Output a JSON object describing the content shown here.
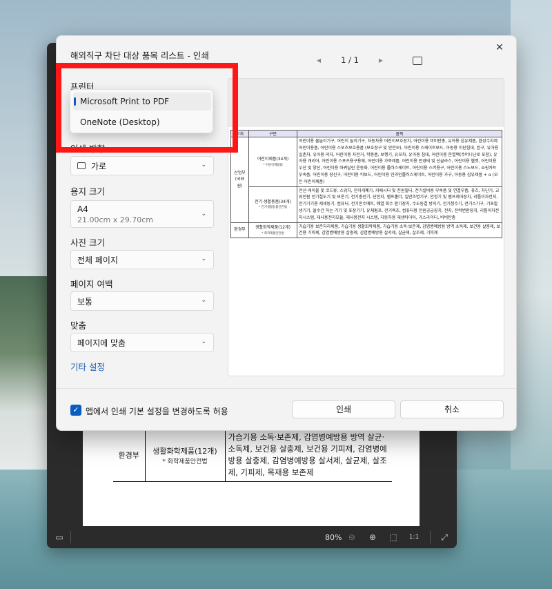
{
  "viewer": {
    "table": {
      "ministry": "환경부",
      "category": "생활화학제품(12개)",
      "category_sub": "* 화학제품안전법",
      "items": "가습기용 소독·보존제, 감염병예방용 방역 살균·소독제, 보건용 살충제, 보건용 기피제, 감염병예방용 살충제, 감염병예방용 살서제, 살균제, 살조제, 기피제, 목재용 보존제"
    },
    "zoom": "80%"
  },
  "dialog": {
    "title": "해외직구 차단 대상 품목 리스트 - 인쇄",
    "page_indicator": "1 / 1",
    "printer_label": "프린터",
    "printer_options": [
      "Microsoft Print to PDF",
      "OneNote (Desktop)"
    ],
    "orientation_label": "인쇄 방향",
    "orientation_value": "가로",
    "paper_label": "용지 크기",
    "paper_value": "A4",
    "paper_dims": "21.00cm x 29.70cm",
    "photo_label": "사진 크기",
    "photo_value": "전체 페이지",
    "margin_label": "페이지 여백",
    "margin_value": "보통",
    "fit_label": "맞춤",
    "fit_value": "페이지에 맞춤",
    "more_settings": "기타 설정",
    "allow_checkbox": "앱에서 인쇄 기본 설정을 변경하도록 허용",
    "print_button": "인쇄",
    "cancel_button": "취소"
  },
  "preview": {
    "headers": [
      "부처",
      "구분",
      "품목"
    ],
    "rows": [
      {
        "ministry": "산업부",
        "ministry_sub": "(국표원)",
        "category": "어린이제품(34개)",
        "category_sub": "* 어린이제품법",
        "items": "어린이용 물놀이기구, 어린이 놀이기구, 자동차용 어린이보호장치, 어린이용 비비탄총, 유아용 섬유제품, 합성수지제 어린이용품, 어린이용 스포츠보호용품 (보호장구 및 안전모), 어린이용 스케이트보드, 아동용 이단침대, 완구, 유아용 실촌차, 유아용 의자, 어린이용 자전거, 학용품, 보행기, 유모차, 유아용 침대, 어린이용 온열팩(주머니난로 포함), 유아용 캐리어, 어린이용 스포츠용구용체, 어린이용 가죽제품, 어린이용 안경테 및 선글라스, 어린이용 헬멧, 어린이용 우산 및 양산, 어린이용 바퀴달린 운동화, 어린이용 롤러스케이트, 어린이용 스키용구, 어린이용 스노보드, 쇼핑카트 부속품, 어린이용 장신구, 어린이용 킥보드, 어린이용 인라인롤러스케이트, 어린이용 가구, 아동용 섬유제품 + α (모든 어린이제품)"
      },
      {
        "ministry": "",
        "ministry_sub": "",
        "category": "전기·생활용품(34개)",
        "category_sub": "* 전기생활용품안전법",
        "items": "전선·케이블 및 코드류, 스위치, 전자개폐기, 커패시터 및 전원필터, 전기설비용 부속품 및 연결부품, 퓨즈, 차단기, 교류전원 전기철도기 및 보온기, 전기충전기, 단전지, 램프홀더, 일반조명기구, 안정기 및 램프제어장치, 리튬이차전지, 전기기기용 제세동기, 컴퓨터, 전기온수매트, 폐열 회수 환기장치, 수도동결 방지기, 전기청수기, 전기스기구, 기포발생기기, 물수건 하는 기기 및 포장기기, 유체펌프, 전기욕조, 컴퓨터용 전원공급장치, 전지, 전력변환장치, 리튬이차전지시스템, 재사용전지모듈, 재사용전지 시스템, 자동차용 재생타이어, 가스라이터, 비비탄총"
      },
      {
        "ministry": "환경부",
        "ministry_sub": "",
        "category": "생활화학제품(12개)",
        "category_sub": "* 화학제품안전법",
        "items": "가습기용 보존처리제품, 가습기용 생활화학제품, 가습기용 소독·보존제, 감염병예방용 방역 소독제, 보건용 살충제, 보건용 기피제, 감염병예방용 살충제, 감염병예방용 살서제, 살균제, 살조제, 기피제"
      }
    ]
  },
  "colors": {
    "accent": "#0a5cc2",
    "highlight": "#ff1717",
    "link": "#1a5fb4"
  }
}
